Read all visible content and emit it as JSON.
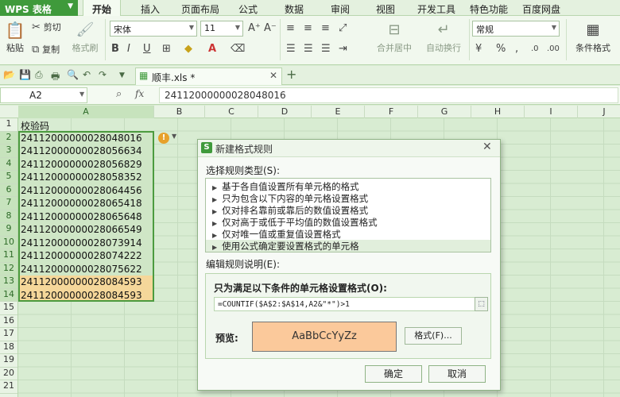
{
  "app": {
    "title": "WPS 表格"
  },
  "menu": [
    "开始",
    "插入",
    "页面布局",
    "公式",
    "数据",
    "审阅",
    "视图",
    "开发工具",
    "特色功能",
    "百度网盘"
  ],
  "ribbon": {
    "paste": "粘贴",
    "cut": "剪切",
    "copy": "复制",
    "format_painter": "格式刷",
    "font": "宋体",
    "font_size": "11",
    "merge": "合并居中",
    "wrap": "自动换行",
    "number_format": "常规",
    "cond_format": "条件格式"
  },
  "file_tab": "顺丰.xls *",
  "name_box": "A2",
  "formula_bar": "24112000000028048016",
  "columns": [
    "A",
    "B",
    "C",
    "D",
    "E",
    "F",
    "G",
    "H",
    "I",
    "J"
  ],
  "rows": [
    "1",
    "2",
    "3",
    "4",
    "5",
    "6",
    "7",
    "8",
    "9",
    "10",
    "11",
    "12",
    "13",
    "14",
    "15",
    "16",
    "17",
    "18",
    "19",
    "20",
    "21"
  ],
  "cells_a": [
    {
      "v": "校验码",
      "s": "plain"
    },
    {
      "v": "24112000000028048016",
      "s": "rng"
    },
    {
      "v": "24112000000028056634",
      "s": "rng"
    },
    {
      "v": "24112000000028056829",
      "s": "rng"
    },
    {
      "v": "24112000000028058352",
      "s": "rng"
    },
    {
      "v": "24112000000028064456",
      "s": "rng"
    },
    {
      "v": "24112000000028065418",
      "s": "rng"
    },
    {
      "v": "24112000000028065648",
      "s": "rng"
    },
    {
      "v": "24112000000028066549",
      "s": "rng"
    },
    {
      "v": "24112000000028073914",
      "s": "rng"
    },
    {
      "v": "24112000000028074222",
      "s": "rng"
    },
    {
      "v": "24112000000028075622",
      "s": "rng"
    },
    {
      "v": "24112000000028084593",
      "s": "hl"
    },
    {
      "v": "24112000000028084593",
      "s": "hl"
    }
  ],
  "dialog": {
    "title": "新建格式规则",
    "select_type_label": "选择规则类型(S):",
    "rules": [
      "基于各自值设置所有单元格的格式",
      "只为包含以下内容的单元格设置格式",
      "仅对排名靠前或靠后的数值设置格式",
      "仅对高于或低于平均值的数值设置格式",
      "仅对唯一值或重复值设置格式",
      "使用公式确定要设置格式的单元格"
    ],
    "selected_rule": 5,
    "edit_desc_label": "编辑规则说明(E):",
    "formula_label": "只为满足以下条件的单元格设置格式(O):",
    "formula": "=COUNTIF($A$2:$A$14,A2&\"*\")>1",
    "preview_label": "预览:",
    "preview_text": "AaBbCcYyZz",
    "preview_color": "#fbc99b",
    "format_button": "格式(F)...",
    "ok": "确定",
    "cancel": "取消"
  },
  "colors": {
    "accent": "#3f9a3b",
    "highlight": "#f5d79a",
    "selection": "#4c9b3f"
  }
}
